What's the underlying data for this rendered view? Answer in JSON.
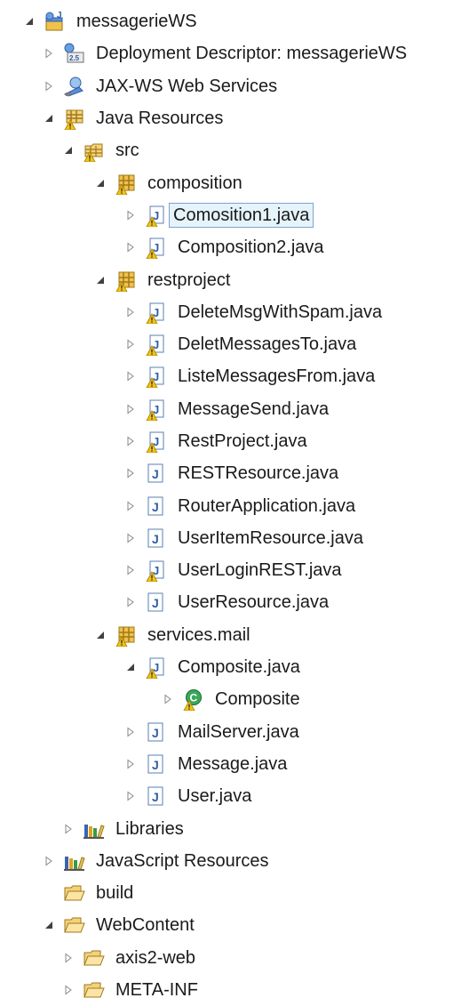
{
  "project_explorer": {
    "items": [
      {
        "label": "messagerieWS",
        "icon": "web-project-icon",
        "level": 0,
        "toggle": "expanded"
      },
      {
        "label": "Deployment Descriptor: messagerieWS",
        "icon": "deployment-descriptor-icon",
        "level": 1,
        "toggle": "collapsed"
      },
      {
        "label": "JAX-WS Web Services",
        "icon": "web-services-icon",
        "level": 1,
        "toggle": "collapsed"
      },
      {
        "label": "Java Resources",
        "icon": "java-resources-icon",
        "level": 1,
        "toggle": "expanded"
      },
      {
        "label": "src",
        "icon": "source-folder-icon",
        "level": 2,
        "toggle": "expanded"
      },
      {
        "label": "composition",
        "icon": "package-icon",
        "level": 3,
        "toggle": "expanded"
      },
      {
        "label": "Comosition1.java",
        "icon": "java-file-warning-icon",
        "level": 4,
        "toggle": "collapsed",
        "selected": true
      },
      {
        "label": "Composition2.java",
        "icon": "java-file-warning-icon",
        "level": 4,
        "toggle": "collapsed"
      },
      {
        "label": "restproject",
        "icon": "package-icon",
        "level": 3,
        "toggle": "expanded"
      },
      {
        "label": "DeleteMsgWithSpam.java",
        "icon": "java-file-warning-icon",
        "level": 4,
        "toggle": "collapsed"
      },
      {
        "label": "DeletMessagesTo.java",
        "icon": "java-file-warning-icon",
        "level": 4,
        "toggle": "collapsed"
      },
      {
        "label": "ListeMessagesFrom.java",
        "icon": "java-file-warning-icon",
        "level": 4,
        "toggle": "collapsed"
      },
      {
        "label": "MessageSend.java",
        "icon": "java-file-warning-icon",
        "level": 4,
        "toggle": "collapsed"
      },
      {
        "label": "RestProject.java",
        "icon": "java-file-warning-icon",
        "level": 4,
        "toggle": "collapsed"
      },
      {
        "label": "RESTResource.java",
        "icon": "java-file-icon",
        "level": 4,
        "toggle": "collapsed"
      },
      {
        "label": "RouterApplication.java",
        "icon": "java-file-icon",
        "level": 4,
        "toggle": "collapsed"
      },
      {
        "label": "UserItemResource.java",
        "icon": "java-file-icon",
        "level": 4,
        "toggle": "collapsed"
      },
      {
        "label": "UserLoginREST.java",
        "icon": "java-file-warning-icon",
        "level": 4,
        "toggle": "collapsed"
      },
      {
        "label": "UserResource.java",
        "icon": "java-file-icon",
        "level": 4,
        "toggle": "collapsed"
      },
      {
        "label": "services.mail",
        "icon": "package-icon",
        "level": 3,
        "toggle": "expanded"
      },
      {
        "label": "Composite.java",
        "icon": "java-file-warning-icon",
        "level": 4,
        "toggle": "expanded"
      },
      {
        "label": "Composite",
        "icon": "class-warning-icon",
        "level": 5,
        "toggle": "collapsed"
      },
      {
        "label": "MailServer.java",
        "icon": "java-file-icon",
        "level": 4,
        "toggle": "collapsed"
      },
      {
        "label": "Message.java",
        "icon": "java-file-icon",
        "level": 4,
        "toggle": "collapsed"
      },
      {
        "label": "User.java",
        "icon": "java-file-icon",
        "level": 4,
        "toggle": "collapsed"
      },
      {
        "label": "Libraries",
        "icon": "libraries-icon",
        "level": 2,
        "toggle": "collapsed"
      },
      {
        "label": "JavaScript Resources",
        "icon": "libraries-icon",
        "level": 1,
        "toggle": "collapsed"
      },
      {
        "label": "build",
        "icon": "folder-icon",
        "level": 1,
        "toggle": "none"
      },
      {
        "label": "WebContent",
        "icon": "folder-icon",
        "level": 1,
        "toggle": "expanded"
      },
      {
        "label": "axis2-web",
        "icon": "folder-icon",
        "level": 2,
        "toggle": "collapsed"
      },
      {
        "label": "META-INF",
        "icon": "folder-icon",
        "level": 2,
        "toggle": "collapsed"
      }
    ]
  },
  "colors": {
    "selection_bg": "#e5f3fb",
    "selection_border": "#7da2ce",
    "text": "#1a1a1a",
    "twistie": "#8a8a8a"
  }
}
